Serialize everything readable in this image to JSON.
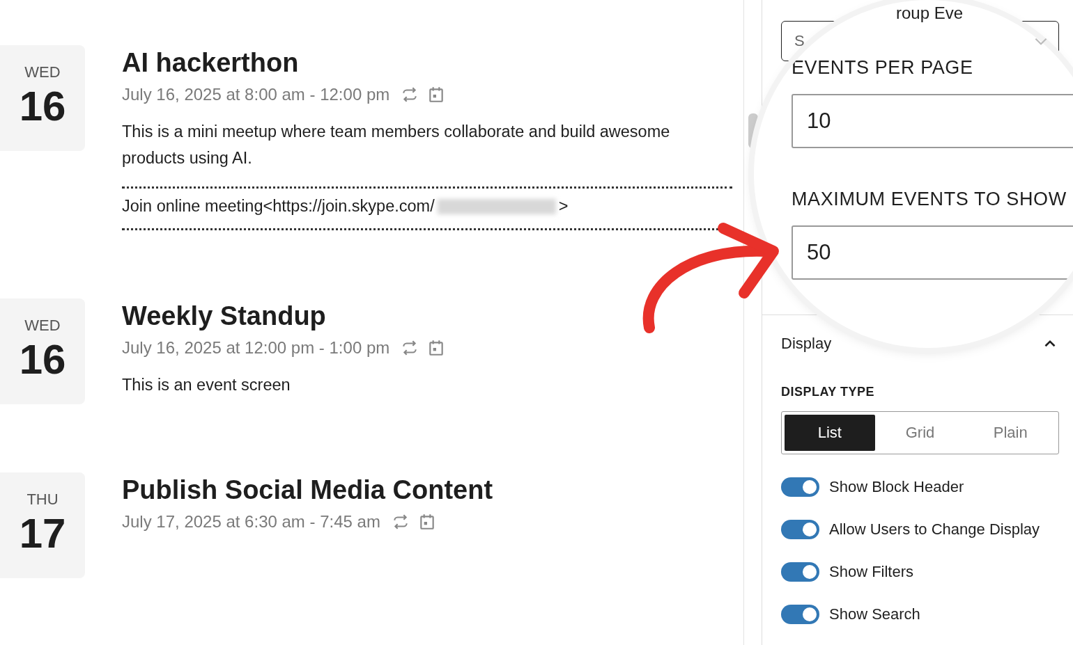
{
  "events": [
    {
      "weekday": "WED",
      "day": "16",
      "title": "AI hackerthon",
      "datetime": "July 16, 2025 at 8:00 am - 12:00 pm",
      "description": "This is a mini meetup where team members collaborate and build awesome products using AI.",
      "meeting": {
        "text": "Join online meeting<https://join.skype.com/",
        "redacted": true,
        "suffix": ">"
      }
    },
    {
      "weekday": "WED",
      "day": "16",
      "title": "Weekly Standup",
      "datetime": "July 16, 2025 at 12:00 pm - 1:00 pm",
      "description": "This is an event screen"
    },
    {
      "weekday": "THU",
      "day": "17",
      "title": "Publish Social Media Content",
      "datetime": "July 17, 2025 at 6:30 am - 7:45 am"
    }
  ],
  "sidebar": {
    "select": {
      "placeholder": "S"
    },
    "magnifier": {
      "heading": "roup Eve",
      "fields": [
        {
          "label": "EVENTS PER PAGE",
          "value": "10"
        },
        {
          "label": "MAXIMUM EVENTS TO SHOW",
          "value": "50"
        }
      ]
    },
    "display": {
      "title": "Display",
      "expanded": true,
      "type_label": "DISPLAY TYPE",
      "options": [
        {
          "label": "List",
          "selected": true
        },
        {
          "label": "Grid",
          "selected": false
        },
        {
          "label": "Plain",
          "selected": false
        }
      ],
      "toggles": [
        {
          "label": "Show Block Header",
          "on": true
        },
        {
          "label": "Allow Users to Change Display",
          "on": true
        },
        {
          "label": "Show Filters",
          "on": true
        },
        {
          "label": "Show Search",
          "on": true
        }
      ]
    }
  }
}
